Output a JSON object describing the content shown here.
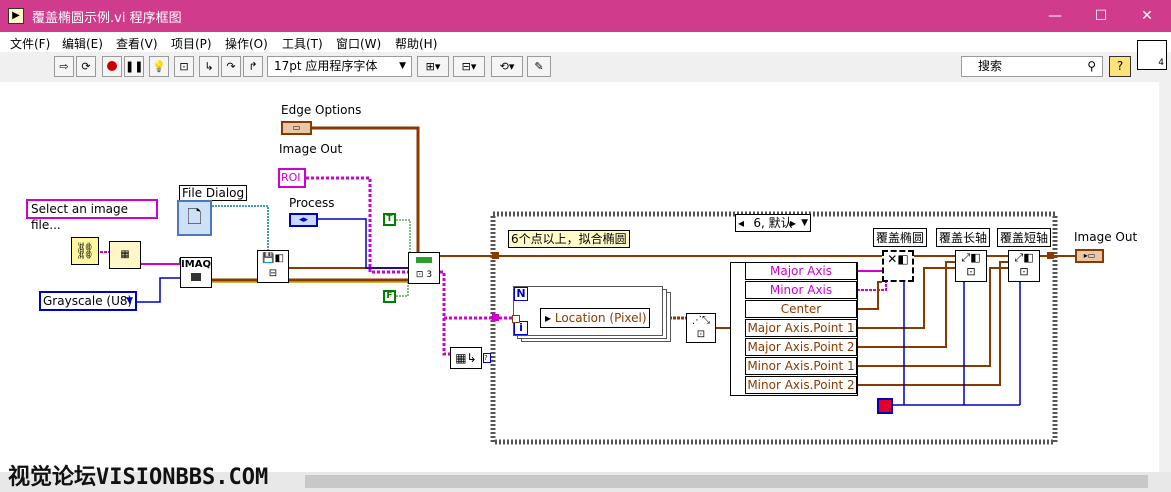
{
  "window": {
    "title": "覆盖椭圆示例.vi 程序框图",
    "minimize_glyph": "—",
    "maximize_glyph": "☐",
    "close_glyph": "✕"
  },
  "menu": {
    "items": [
      {
        "label": "文件(F)"
      },
      {
        "label": "编辑(E)"
      },
      {
        "label": "查看(V)"
      },
      {
        "label": "项目(P)"
      },
      {
        "label": "操作(O)"
      },
      {
        "label": "工具(T)"
      },
      {
        "label": "窗口(W)"
      },
      {
        "label": "帮助(H)"
      }
    ]
  },
  "toolbar": {
    "font_selector": "17pt 应用程序字体",
    "search_placeholder": "搜索",
    "help_label": "?",
    "context_icon_number": "4"
  },
  "diagram": {
    "path_constant": "Select an image file...",
    "file_dialog_label": "File Dialog",
    "image_type": "Grayscale (U8)",
    "imaq_label": "IMAQ",
    "edge_options_label": "Edge Options",
    "image_out_label": "Image Out",
    "roi_label": "ROI",
    "process_label": "Process",
    "true_label": "T",
    "false_label": "F",
    "case_selector": "6, 默认",
    "case_comment": "6个点以上，拟合椭圆",
    "loop_count_label": "N",
    "loop_index_label": "i",
    "location_label": "Location (Pixel)",
    "property_items": [
      {
        "label": "Major Axis",
        "color": "#d000d0"
      },
      {
        "label": "Minor Axis",
        "color": "#d000d0"
      },
      {
        "label": "Center",
        "color": "#8a3a00"
      },
      {
        "label": "Major Axis.Point 1",
        "color": "#8a3a00"
      },
      {
        "label": "Major Axis.Point 2",
        "color": "#8a3a00"
      },
      {
        "label": "Minor Axis.Point 1",
        "color": "#8a3a00"
      },
      {
        "label": "Minor Axis.Point 2",
        "color": "#8a3a00"
      }
    ],
    "overlay_ellipse_label": "覆盖椭圆",
    "overlay_major_label": "覆盖长轴",
    "overlay_minor_label": "覆盖短轴",
    "image_out_indicator_label": "Image Out"
  },
  "watermark": "视觉论坛VISIONBBS.COM",
  "colors": {
    "titlebar": "#d13b8c",
    "image_wire": "#8a3a00",
    "path_wire": "#d000d0",
    "refnum_wire": "#008080",
    "enum_wire": "#0000c0",
    "bool_wire": "#008000"
  }
}
